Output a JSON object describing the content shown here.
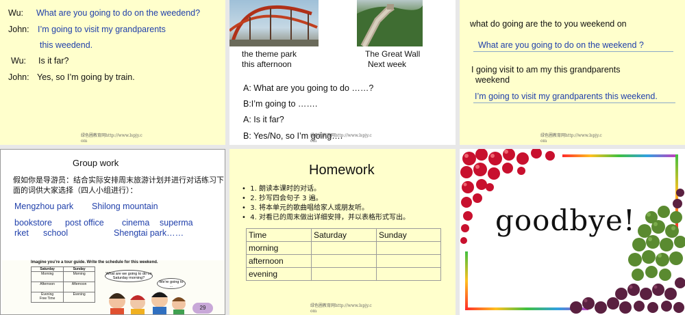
{
  "slide1": {
    "lines": [
      {
        "speaker": "Wu:",
        "text": "What are you going to do on the weedend?"
      },
      {
        "speaker": "John:",
        "text": "I’m going to visit my  grandparents"
      },
      {
        "speaker": "",
        "text": "this weedend."
      },
      {
        "speaker": "Wu:",
        "text": "Is it far?"
      },
      {
        "speaker": "John:",
        "text": "Yes, so I’m going by train."
      }
    ],
    "watermark": {
      "line1": "绿色圃教育网http://www.lspjy.c",
      "line2": "om"
    }
  },
  "slide2": {
    "caption1": {
      "line1": "the theme park",
      "line2": "this afternoon"
    },
    "caption2": {
      "line1": "The Great Wall",
      "line2": "Next week"
    },
    "q1": "A: What are you going to do ……?",
    "q2": "B:I’m going to …….",
    "q3": "A: Is it  far?",
    "q4": "B: Yes/No, so I’m going….",
    "watermark": {
      "line1": "绿色圃教育网http://www.lspjy.c",
      "line2": "om"
    }
  },
  "slide3": {
    "scramble1": "what  do   going   are  the  to  you   weekend  on",
    "answer1": "What are you going to do on the weekend ?",
    "scramble2_l1": "I   going   visit   to   am   my   this   grandparents",
    "scramble2_l2": "weekend",
    "answer2": "I’m going to visit my grandparents this weekend.",
    "watermark": {
      "line1": "绿色圃教育网http://www.lspjy.c",
      "line2": "om"
    }
  },
  "slide4": {
    "title": "Group work",
    "instr_l1": "假如你是导游员：结合实际安排周末旅游计划并进行对话练习下",
    "instr_l2": "面的词供大家选择（四人小组进行）：",
    "places_l1a": "Mengzhou park",
    "places_l1b": "Shilong mountain",
    "places_l2a": "bookstore",
    "places_l2b": "post office",
    "places_l2c": "cinema",
    "places_l2d": "superma",
    "places_l3a": "rket",
    "places_l3b": "school",
    "places_l3c": "Shengtai park……",
    "image_caption": "Imagine you’re a tour guide. Write the schedule for this weekend.",
    "mini_table": [
      [
        "Saturday",
        "Sunday"
      ],
      [
        "Morning",
        "Morning"
      ],
      [
        "Afternoon",
        "Afternoon"
      ],
      [
        "Evening\nFree Time",
        "Evening"
      ]
    ],
    "bubble1": "What are we going to do on Saturday morning?",
    "bubble2": "We're going to ...",
    "page_number": "29"
  },
  "slide5": {
    "title": "Homework",
    "items": [
      "1. 朗读本课时的对话。",
      "2. 抄写四会句子 3 遍。",
      "3. 将本单元的歌曲唱给家人或朋友听。",
      "4. 对看已的周末做出详细安排，并以表格形式写出。"
    ],
    "table": [
      [
        "Time",
        "Saturday",
        "Sunday"
      ],
      [
        "morning",
        "",
        ""
      ],
      [
        "afternoon",
        "",
        ""
      ],
      [
        "evening",
        "",
        ""
      ]
    ],
    "watermark": {
      "line1": "绿色圃教育网http://www.lspjy.c",
      "line2": "om"
    }
  },
  "slide6": {
    "text": "goodbye!"
  },
  "colors": {
    "slide_yellow": "#ffffcc",
    "text_blue": "#1f3faa",
    "border_gray": "#e8e8e8"
  }
}
